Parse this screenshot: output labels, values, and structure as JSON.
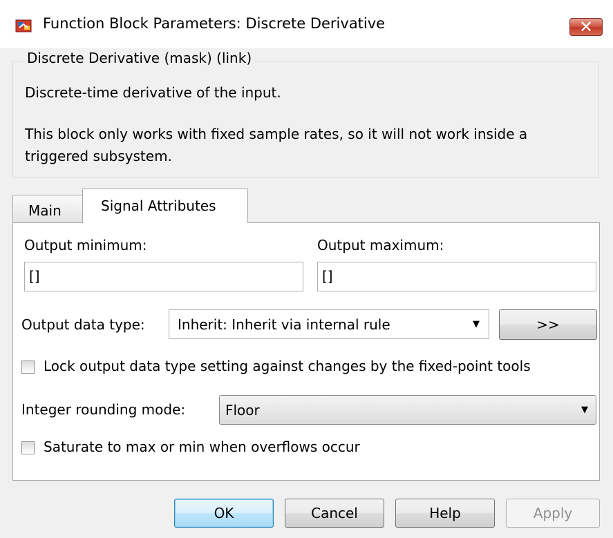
{
  "window": {
    "title": "Function Block Parameters: Discrete Derivative",
    "close_label": "✕"
  },
  "description": {
    "legend": "Discrete Derivative (mask) (link)",
    "line1": "Discrete-time derivative of the input.",
    "line2": "This block only works with fixed sample rates, so it will not work inside a triggered subsystem."
  },
  "tabs": [
    {
      "label": "Main",
      "active": false
    },
    {
      "label": "Signal Attributes",
      "active": true
    }
  ],
  "signal": {
    "output_min_label": "Output minimum:",
    "output_min_value": "[]",
    "output_max_label": "Output maximum:",
    "output_max_value": "[]",
    "data_type_label": "Output data type:",
    "data_type_value": "Inherit: Inherit via internal rule",
    "assistant_button": ">>",
    "lock_label": "Lock output data type setting against changes by the fixed-point tools",
    "lock_checked": false,
    "rounding_label": "Integer rounding mode:",
    "rounding_value": "Floor",
    "saturate_label": "Saturate to max or min when overflows occur",
    "saturate_checked": false
  },
  "buttons": {
    "ok": "OK",
    "cancel": "Cancel",
    "help": "Help",
    "apply": "Apply"
  },
  "colors": {
    "dialog_bg": "#f0f0f0",
    "close_button": "#c23a26",
    "ok_accent": "#3c7fb1"
  },
  "icons": {
    "title": "simulink-block-icon",
    "close": "close-icon",
    "dropdown": "chevron-down-icon"
  }
}
